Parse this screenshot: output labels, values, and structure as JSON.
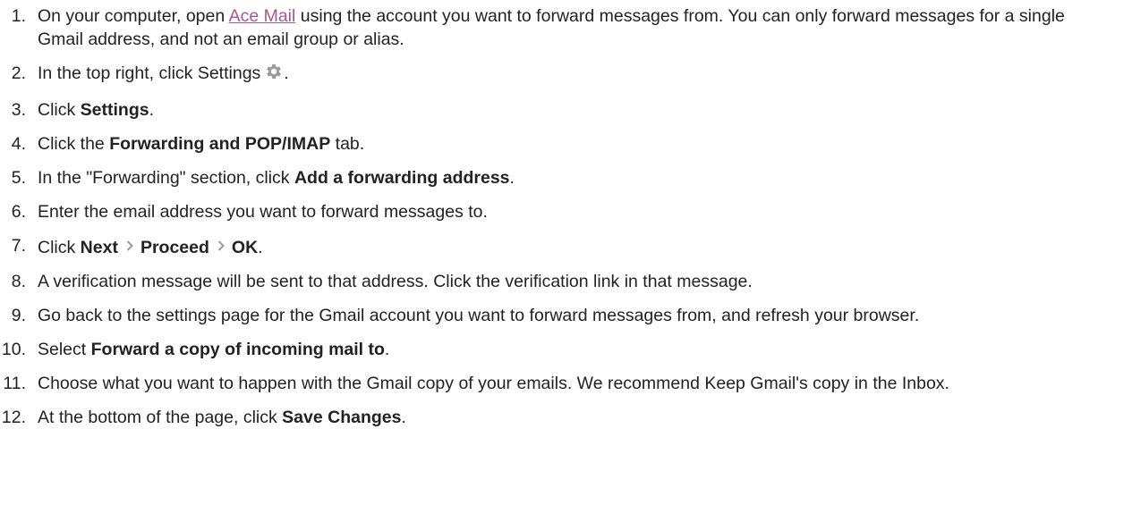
{
  "steps": [
    {
      "number": "1.",
      "pre": "On your computer, open ",
      "link": "Ace Mail",
      "post": " using the account you want to forward messages from. You can only forward messages for a single Gmail address, and not an email group or alias."
    },
    {
      "number": "2.",
      "pre": "In the top right, click Settings",
      "icon": "gear-icon",
      "post": "."
    },
    {
      "number": "3.",
      "pre": "Click ",
      "bold": "Settings",
      "post": "."
    },
    {
      "number": "4.",
      "pre": "Click the ",
      "bold": "Forwarding and POP/IMAP",
      "post": " tab."
    },
    {
      "number": "5.",
      "pre": "In the \"Forwarding\" section, click ",
      "bold": "Add a forwarding address",
      "post": "."
    },
    {
      "number": "6.",
      "pre": "Enter the email address you want to forward messages to."
    },
    {
      "number": "7.",
      "pre": "Click ",
      "bold1": "Next",
      "separator_icon": "chevron-right-icon",
      "bold2": "Proceed",
      "bold3": "OK",
      "post": "."
    },
    {
      "number": "8.",
      "pre": "A verification message will be sent to that address. Click the verification link in that message."
    },
    {
      "number": "9.",
      "pre": "Go back to the settings page for the Gmail account you want to forward messages from, and refresh your browser."
    },
    {
      "number": "10.",
      "pre": "Select ",
      "bold": "Forward a copy of incoming mail to",
      "post": "."
    },
    {
      "number": "11.",
      "pre": "Choose what you want to happen with the Gmail copy of your emails. We recommend Keep Gmail's copy in the Inbox."
    },
    {
      "number": "12.",
      "pre": "At the bottom of the page, click ",
      "bold": "Save Changes",
      "post": "."
    }
  ],
  "colors": {
    "text": "#222222",
    "link": "#a05a8c",
    "icon": "#9a9a9a"
  }
}
